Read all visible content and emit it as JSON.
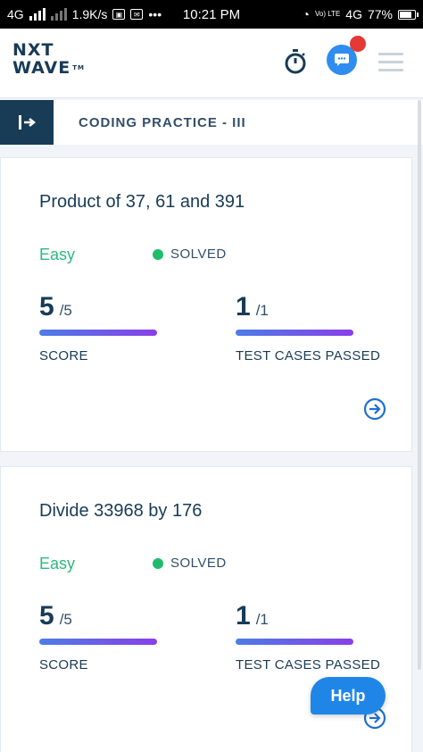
{
  "statusbar": {
    "network": "4G",
    "speed": "1.9K/s",
    "time": "10:21 PM",
    "volte": "Vo) LTE",
    "network2": "4G",
    "battery": "77%"
  },
  "header": {
    "logo_line1": "NXT",
    "logo_line2": "WAVE",
    "logo_tm": "TM"
  },
  "breadcrumb": {
    "title": "CODING PRACTICE - III"
  },
  "problems": [
    {
      "title": "Product of 37, 61 and 391",
      "difficulty": "Easy",
      "status": "SOLVED",
      "score_value": "5",
      "score_total": "/5",
      "score_label": "SCORE",
      "tests_value": "1",
      "tests_total": "/1",
      "tests_label": "TEST CASES PASSED"
    },
    {
      "title": "Divide 33968 by 176",
      "difficulty": "Easy",
      "status": "SOLVED",
      "score_value": "5",
      "score_total": "/5",
      "score_label": "SCORE",
      "tests_value": "1",
      "tests_total": "/1",
      "tests_label": "TEST CASES PASSED"
    }
  ],
  "help_button": "Help",
  "colors": {
    "brand_dark": "#183b56",
    "easy_green": "#2eb87f",
    "solved_dot": "#1ebc6c",
    "accent_blue": "#1f86e8"
  },
  "icons": [
    "stopwatch-icon",
    "chat-icon",
    "menu-icon",
    "sidebar-toggle-icon",
    "arrow-circle-right-icon"
  ]
}
